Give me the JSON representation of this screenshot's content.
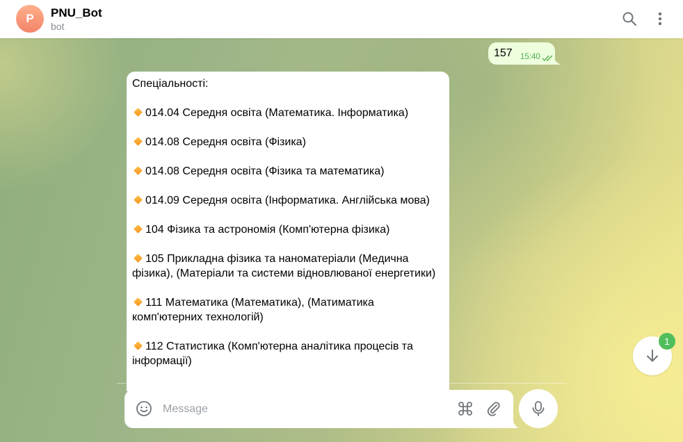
{
  "header": {
    "avatar_letter": "P",
    "title": "PNU_Bot",
    "subtitle": "bot",
    "icons": [
      "search-icon",
      "more-vertical-icon"
    ]
  },
  "messages": {
    "outgoing": {
      "text": "157",
      "time": "15:40",
      "status_icon": "double-check-icon"
    },
    "incoming": {
      "lines": [
        "Спеціальності:",
        "014.04 Середня освіта (Математика. Інформатика)",
        "014.08 Середня освіта (Фізика)",
        "014.08 Середня освіта (Фізика та математика)",
        "014.09 Середня освіта (Інформатика. Англійська мова)",
        "104 Фізика та астрономія (Комп'ютерна фізика)",
        "105 Прикладна фізика та наноматеріали (Медична фізика), (Матеріали та системи відновлюваної енергетики)",
        "111 Математика (Математика), (Матиматика комп'ютерних технологій)",
        "112 Статистика (Комп'ютерна аналітика процесів та інформації)"
      ],
      "bullet_icon": "orange-diamond-icon"
    }
  },
  "composer": {
    "placeholder": "Message",
    "icons": [
      "emoji-icon",
      "command-icon",
      "attach-icon",
      "microphone-icon"
    ]
  },
  "scroll_down": {
    "icon": "arrow-down-icon",
    "unread_count": "1"
  },
  "colors": {
    "accent": "#3390ec",
    "outgoing_bubble": "#eeffde",
    "outgoing_time": "#4fae4e",
    "unread_badge": "#4fbe5b",
    "avatar": "#f2836a"
  }
}
